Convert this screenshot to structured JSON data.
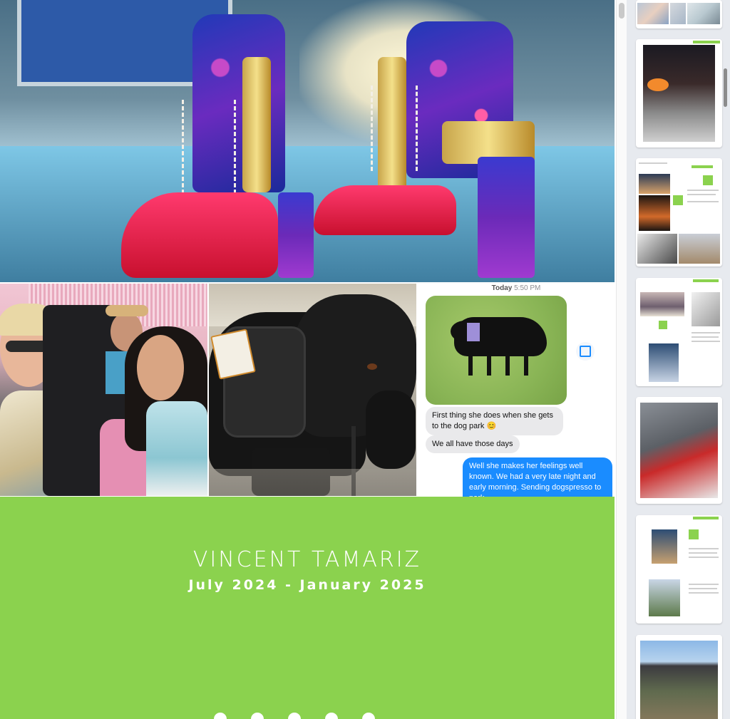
{
  "messages": {
    "time_day": "Today",
    "time_clock": "5:50 PM",
    "incoming_1": "First thing she does when she gets to the dog park 😊",
    "incoming_2": "We all have those days",
    "outgoing_1": "Well she makes her feelings well known. We had a very late night and early morning. Sending dogspresso to park."
  },
  "cover": {
    "title": "VINCENT TAMARIZ",
    "dates": "July 2024 - January 2025"
  },
  "sidebar": {
    "pages": [
      {
        "kind": "photos"
      },
      {
        "kind": "photo-fire"
      },
      {
        "kind": "text-page"
      },
      {
        "kind": "text-page"
      },
      {
        "kind": "photo-car"
      },
      {
        "kind": "text-page"
      },
      {
        "kind": "photo-house"
      }
    ]
  },
  "colors": {
    "cover_green": "#8bd24e",
    "imessage_blue": "#1a8cff",
    "bubble_gray": "#e9e9eb"
  }
}
